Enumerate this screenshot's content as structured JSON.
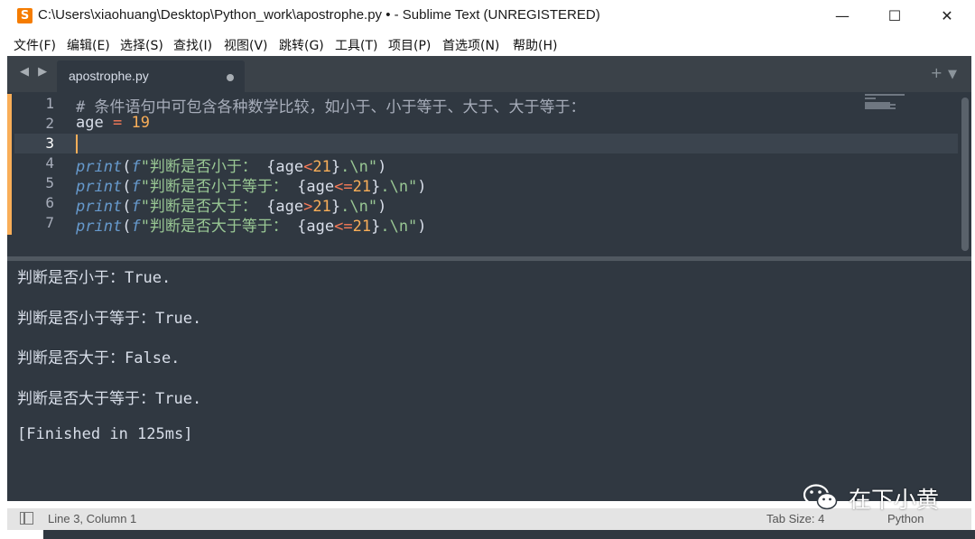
{
  "window": {
    "title": "C:\\Users\\xiaohuang\\Desktop\\Python_work\\apostrophe.py • - Sublime Text (UNREGISTERED)",
    "app_icon": "sublime-text-logo",
    "controls": {
      "minimize": "—",
      "maximize": "☐",
      "close": "✕"
    }
  },
  "menu": [
    "文件(F)",
    "编辑(E)",
    "选择(S)",
    "查找(I)",
    "视图(V)",
    "跳转(G)",
    "工具(T)",
    "项目(P)",
    "首选项(N)",
    "帮助(H)"
  ],
  "tabs": {
    "nav": "◀ ▶",
    "active": {
      "label": "apostrophe.py",
      "modified": true
    },
    "new_tab": "+",
    "dropdown": "▼"
  },
  "editor": {
    "line_numbers": [
      "1",
      "2",
      "3",
      "4",
      "5",
      "6",
      "7"
    ],
    "current_line": 3,
    "lines": [
      [
        {
          "t": "# 条件语句中可包含各种数学比较，如小于、小于等于、大于、大于等于：",
          "c": "cmt"
        }
      ],
      [
        {
          "t": "age ",
          "c": ""
        },
        {
          "t": "=",
          "c": "op"
        },
        {
          "t": " ",
          "c": ""
        },
        {
          "t": "19",
          "c": "num"
        }
      ],
      [],
      [
        {
          "t": "print",
          "c": "kw"
        },
        {
          "t": "(",
          "c": ""
        },
        {
          "t": "f",
          "c": "kw"
        },
        {
          "t": "\"判断是否小于：",
          "c": "str"
        },
        {
          "t": " {age",
          "c": ""
        },
        {
          "t": "<",
          "c": "op"
        },
        {
          "t": "21",
          "c": "num"
        },
        {
          "t": "}",
          "c": ""
        },
        {
          "t": ".\\n\"",
          "c": "str"
        },
        {
          "t": ")",
          "c": ""
        }
      ],
      [
        {
          "t": "print",
          "c": "kw"
        },
        {
          "t": "(",
          "c": ""
        },
        {
          "t": "f",
          "c": "kw"
        },
        {
          "t": "\"判断是否小于等于：",
          "c": "str"
        },
        {
          "t": " {age",
          "c": ""
        },
        {
          "t": "<=",
          "c": "op"
        },
        {
          "t": "21",
          "c": "num"
        },
        {
          "t": "}",
          "c": ""
        },
        {
          "t": ".\\n\"",
          "c": "str"
        },
        {
          "t": ")",
          "c": ""
        }
      ],
      [
        {
          "t": "print",
          "c": "kw"
        },
        {
          "t": "(",
          "c": ""
        },
        {
          "t": "f",
          "c": "kw"
        },
        {
          "t": "\"判断是否大于：",
          "c": "str"
        },
        {
          "t": " {age",
          "c": ""
        },
        {
          "t": ">",
          "c": "op"
        },
        {
          "t": "21",
          "c": "num"
        },
        {
          "t": "}",
          "c": ""
        },
        {
          "t": ".\\n\"",
          "c": "str"
        },
        {
          "t": ")",
          "c": ""
        }
      ],
      [
        {
          "t": "print",
          "c": "kw"
        },
        {
          "t": "(",
          "c": ""
        },
        {
          "t": "f",
          "c": "kw"
        },
        {
          "t": "\"判断是否大于等于：",
          "c": "str"
        },
        {
          "t": " {age",
          "c": ""
        },
        {
          "t": "<=",
          "c": "op"
        },
        {
          "t": "21",
          "c": "num"
        },
        {
          "t": "}",
          "c": ""
        },
        {
          "t": ".\\n\"",
          "c": "str"
        },
        {
          "t": ")",
          "c": ""
        }
      ]
    ]
  },
  "output": [
    "判断是否小于：True.",
    "判断是否小于等于：True.",
    "判断是否大于：False.",
    "判断是否大于等于：True.",
    "[Finished in 125ms]"
  ],
  "status": {
    "position": "Line 3, Column 1",
    "tab_size": "Tab Size: 4",
    "syntax": "Python"
  },
  "watermark": {
    "text": "在下小黄",
    "icon": "wechat-icon"
  },
  "colors": {
    "editor_bg": "#303841",
    "tab_bar_bg": "#3b4249",
    "comment": "#a7adba",
    "keyword": "#6699cc",
    "operator": "#f97b58",
    "number": "#f9ae58",
    "string": "#99c794",
    "app_icon": "#f57c00"
  }
}
